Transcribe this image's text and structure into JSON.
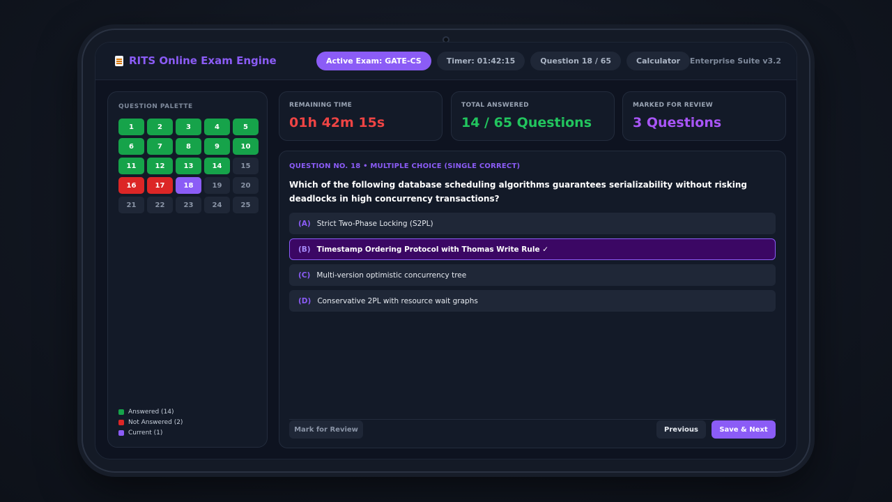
{
  "header": {
    "app_title": "RITS Online Exam Engine",
    "pills": [
      {
        "label": "Active Exam: GATE-CS",
        "active": true
      },
      {
        "label": "Timer: 01:42:15",
        "active": false
      },
      {
        "label": "Question 18 / 65",
        "active": false
      },
      {
        "label": "Calculator",
        "active": false
      }
    ],
    "suite_label": "Enterprise Suite v3.2"
  },
  "palette": {
    "title": "QUESTION PALETTE",
    "questions": [
      {
        "n": "1",
        "status": "answered"
      },
      {
        "n": "2",
        "status": "answered"
      },
      {
        "n": "3",
        "status": "answered"
      },
      {
        "n": "4",
        "status": "answered"
      },
      {
        "n": "5",
        "status": "answered"
      },
      {
        "n": "6",
        "status": "answered"
      },
      {
        "n": "7",
        "status": "answered"
      },
      {
        "n": "8",
        "status": "answered"
      },
      {
        "n": "9",
        "status": "answered"
      },
      {
        "n": "10",
        "status": "answered"
      },
      {
        "n": "11",
        "status": "answered"
      },
      {
        "n": "12",
        "status": "answered"
      },
      {
        "n": "13",
        "status": "answered"
      },
      {
        "n": "14",
        "status": "answered"
      },
      {
        "n": "15",
        "status": "unvisited"
      },
      {
        "n": "16",
        "status": "not-answered"
      },
      {
        "n": "17",
        "status": "not-answered"
      },
      {
        "n": "18",
        "status": "current"
      },
      {
        "n": "19",
        "status": "unvisited"
      },
      {
        "n": "20",
        "status": "unvisited"
      },
      {
        "n": "21",
        "status": "unvisited"
      },
      {
        "n": "22",
        "status": "unvisited"
      },
      {
        "n": "23",
        "status": "unvisited"
      },
      {
        "n": "24",
        "status": "unvisited"
      },
      {
        "n": "25",
        "status": "unvisited"
      }
    ],
    "legend": [
      {
        "label": "Answered (14)",
        "color": "#16a34a"
      },
      {
        "label": "Not Answered (2)",
        "color": "#dc2626"
      },
      {
        "label": "Current (1)",
        "color": "#8b5cf6"
      }
    ]
  },
  "stats": {
    "remaining": {
      "label": "REMAINING TIME",
      "value": "01h 42m 15s",
      "color": "#ef4444"
    },
    "answered": {
      "label": "TOTAL ANSWERED",
      "value": "14 / 65 Questions",
      "color": "#22c55e"
    },
    "review": {
      "label": "MARKED FOR REVIEW",
      "value": "3 Questions",
      "color": "#a855f7"
    }
  },
  "question": {
    "meta": "QUESTION NO. 18 • MULTIPLE CHOICE (SINGLE CORRECT)",
    "text": "Which of the following database scheduling algorithms guarantees serializability without risking deadlocks in high concurrency transactions?",
    "options": [
      {
        "letter": "(A)",
        "text": "Strict Two-Phase Locking (S2PL)",
        "selected": false
      },
      {
        "letter": "(B)",
        "text": "Timestamp Ordering Protocol with Thomas Write Rule ✓",
        "selected": true
      },
      {
        "letter": "(C)",
        "text": "Multi-version optimistic concurrency tree",
        "selected": false
      },
      {
        "letter": "(D)",
        "text": "Conservative 2PL with resource wait graphs",
        "selected": false
      }
    ]
  },
  "footer": {
    "review_label": "Mark for Review",
    "prev_label": "Previous",
    "next_label": "Save & Next"
  }
}
